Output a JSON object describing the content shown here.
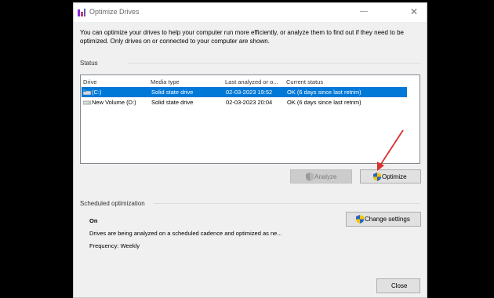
{
  "window": {
    "title": "Optimize Drives",
    "description": "You can optimize your drives to help your computer run more efficiently, or analyze them to find out if they need to be optimized. Only drives on or connected to your computer are shown."
  },
  "status": {
    "label": "Status",
    "columns": [
      "Drive",
      "Media type",
      "Last analyzed or o...",
      "Current status"
    ],
    "rows": [
      {
        "drive": "(C:)",
        "media": "Solid state drive",
        "last": "02-03-2023 19:52",
        "status": "OK (6 days since last retrim)",
        "selected": true
      },
      {
        "drive": "New Volume (D:)",
        "media": "Solid state drive",
        "last": "02-03-2023 20:04",
        "status": "OK (6 days since last retrim)",
        "selected": false
      }
    ]
  },
  "buttons": {
    "analyze": "Analyze",
    "optimize": "Optimize",
    "change_settings": "Change settings",
    "close": "Close"
  },
  "scheduled": {
    "label": "Scheduled optimization",
    "state": "On",
    "description": "Drives are being analyzed on a scheduled cadence and optimized as ne...",
    "frequency": "Frequency: Weekly"
  },
  "colors": {
    "selection": "#0078d7",
    "annotation_arrow": "#d9322f"
  }
}
